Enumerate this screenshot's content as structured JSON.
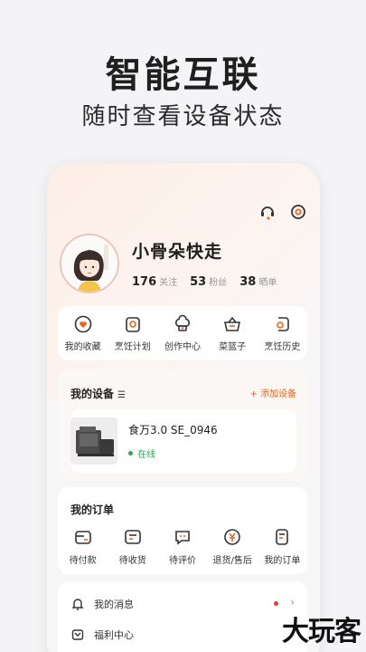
{
  "promo": {
    "title": "智能互联",
    "subtitle": "随时查看设备状态"
  },
  "header": {
    "icons": [
      "headset-icon",
      "settings-icon"
    ]
  },
  "profile": {
    "name": "小骨朵快走",
    "stats": [
      {
        "num": "176",
        "label": "关注"
      },
      {
        "num": "53",
        "label": "粉丝"
      },
      {
        "num": "38",
        "label": "晒单"
      }
    ]
  },
  "quick": [
    {
      "label": "我的收藏",
      "icon": "heart-badge-icon"
    },
    {
      "label": "烹饪计划",
      "icon": "plan-icon"
    },
    {
      "label": "创作中心",
      "icon": "chef-hat-icon"
    },
    {
      "label": "菜篮子",
      "icon": "basket-icon"
    },
    {
      "label": "烹饪历史",
      "icon": "history-icon"
    }
  ],
  "devices": {
    "title": "我的设备",
    "menu_glyph": "☰",
    "add_label": "+ 添加设备",
    "device": {
      "name": "食万3.0 SE_0946",
      "status": "在线"
    }
  },
  "orders": {
    "title": "我的订单",
    "items": [
      {
        "label": "待付款",
        "icon": "wallet-icon"
      },
      {
        "label": "待收货",
        "icon": "package-icon"
      },
      {
        "label": "待评价",
        "icon": "comment-icon"
      },
      {
        "label": "退货/售后",
        "icon": "yen-refund-icon"
      },
      {
        "label": "我的订单",
        "icon": "order-list-icon"
      }
    ]
  },
  "menu": {
    "items": [
      {
        "label": "我的消息",
        "icon": "bell-icon"
      },
      {
        "label": "福利中心",
        "icon": "gift-icon"
      }
    ]
  },
  "colors": {
    "accent": "#e8641f",
    "online": "#2fa44f",
    "notice": "#e53935"
  },
  "watermark": "大玩客"
}
